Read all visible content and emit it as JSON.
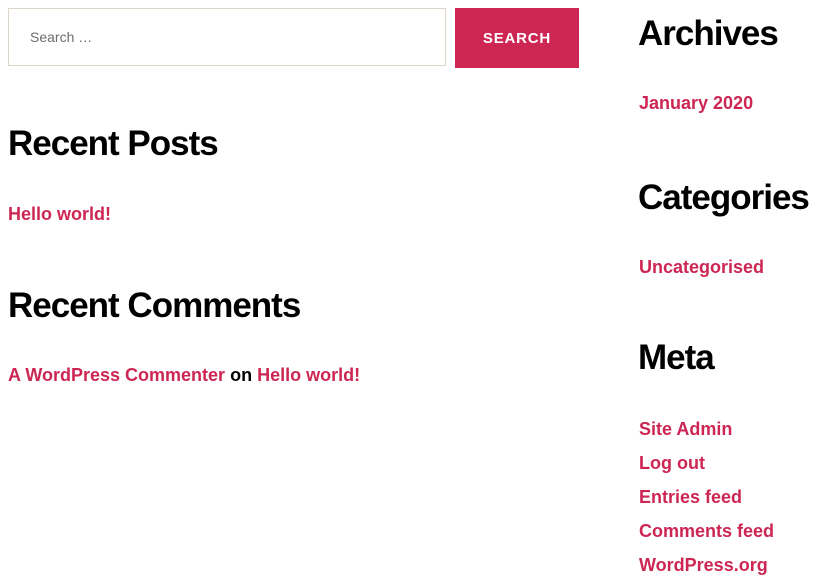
{
  "search": {
    "placeholder": "Search …",
    "button_label": "SEARCH"
  },
  "recent_posts": {
    "title": "Recent Posts",
    "items": [
      "Hello world!"
    ]
  },
  "recent_comments": {
    "title": "Recent Comments",
    "items": [
      {
        "author": "A WordPress Commenter",
        "on": "on",
        "post": "Hello world!"
      }
    ]
  },
  "archives": {
    "title": "Archives",
    "items": [
      "January 2020"
    ]
  },
  "categories": {
    "title": "Categories",
    "items": [
      "Uncategorised"
    ]
  },
  "meta": {
    "title": "Meta",
    "items": [
      "Site Admin",
      "Log out",
      "Entries feed",
      "Comments feed",
      "WordPress.org"
    ]
  },
  "colors": {
    "accent": "#cd2653",
    "text": "#000000",
    "input_border": "#dcd7ca"
  }
}
